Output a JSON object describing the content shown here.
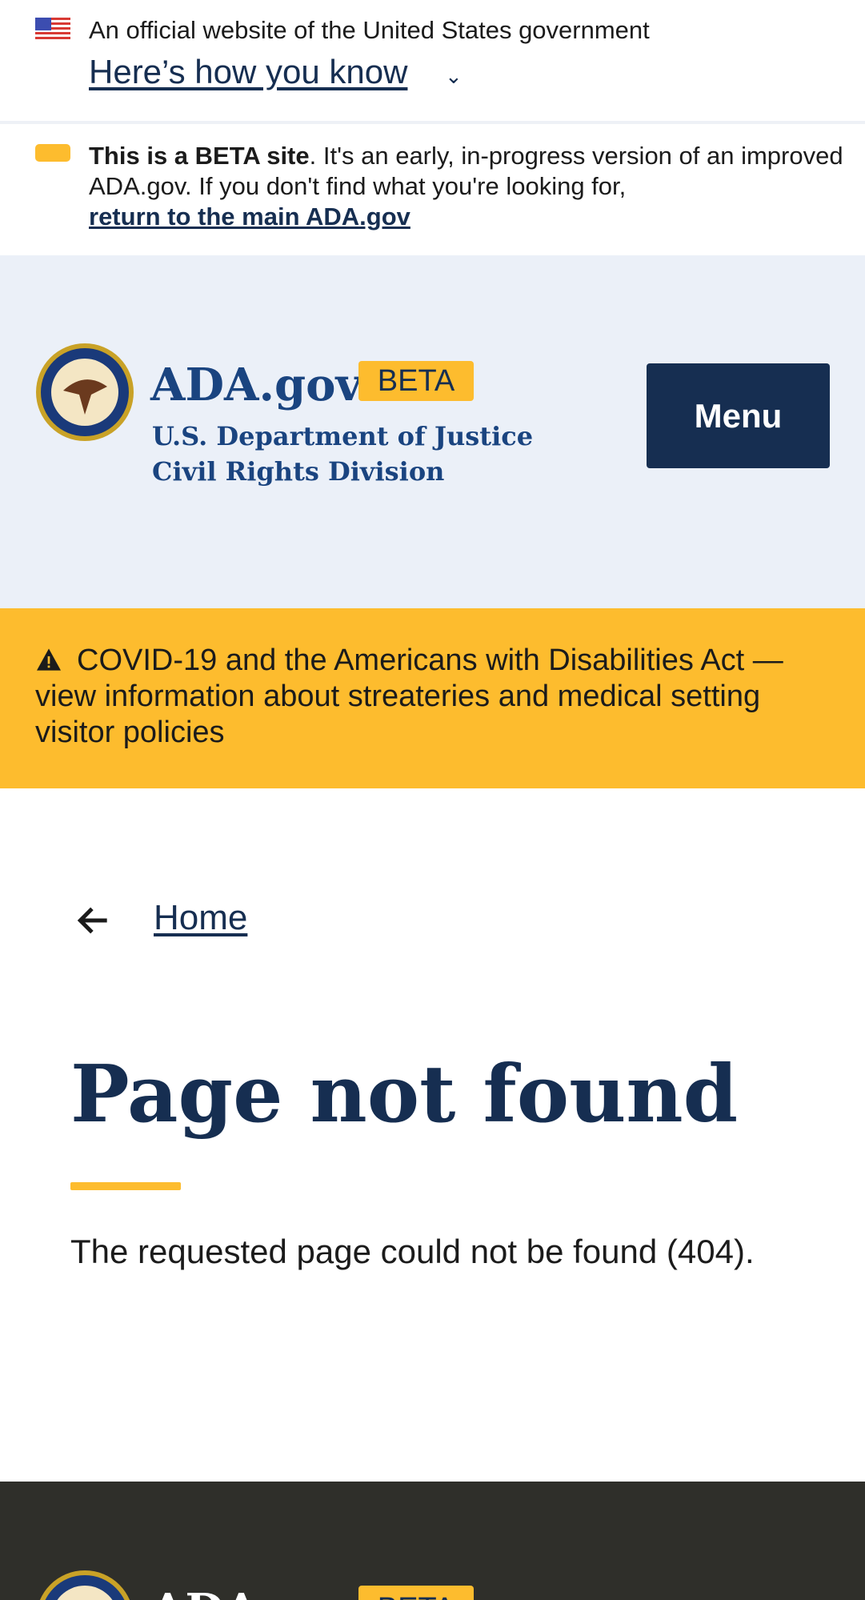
{
  "gov_banner": {
    "text": "An official website of the United States government",
    "link": "Here’s how you know"
  },
  "beta_banner": {
    "bold": "This is a BETA site",
    "text": ". It's an early, in-progress version of an improved ADA.gov. If you don't find what you're looking for, ",
    "link": "return to the main ADA.gov"
  },
  "header": {
    "site_name": "ADA.gov",
    "badge": "BETA",
    "dept_line1": "U.S. Department of Justice",
    "dept_line2": "Civil Rights Division",
    "menu_label": "Menu"
  },
  "alert": {
    "text": "COVID-19 and the Americans with Disabilities Act — view information about streateries and medical setting visitor policies"
  },
  "breadcrumb": {
    "home": "Home"
  },
  "main": {
    "title": "Page not found",
    "message": "The requested page could not be found (404)."
  },
  "footer": {
    "site_name": "ADA.gov",
    "badge": "BETA"
  },
  "colors": {
    "navy": "#162e51",
    "gold": "#fdbc2e",
    "header_bg": "#ebf0f8",
    "footer_bg": "#2f2f2a"
  }
}
